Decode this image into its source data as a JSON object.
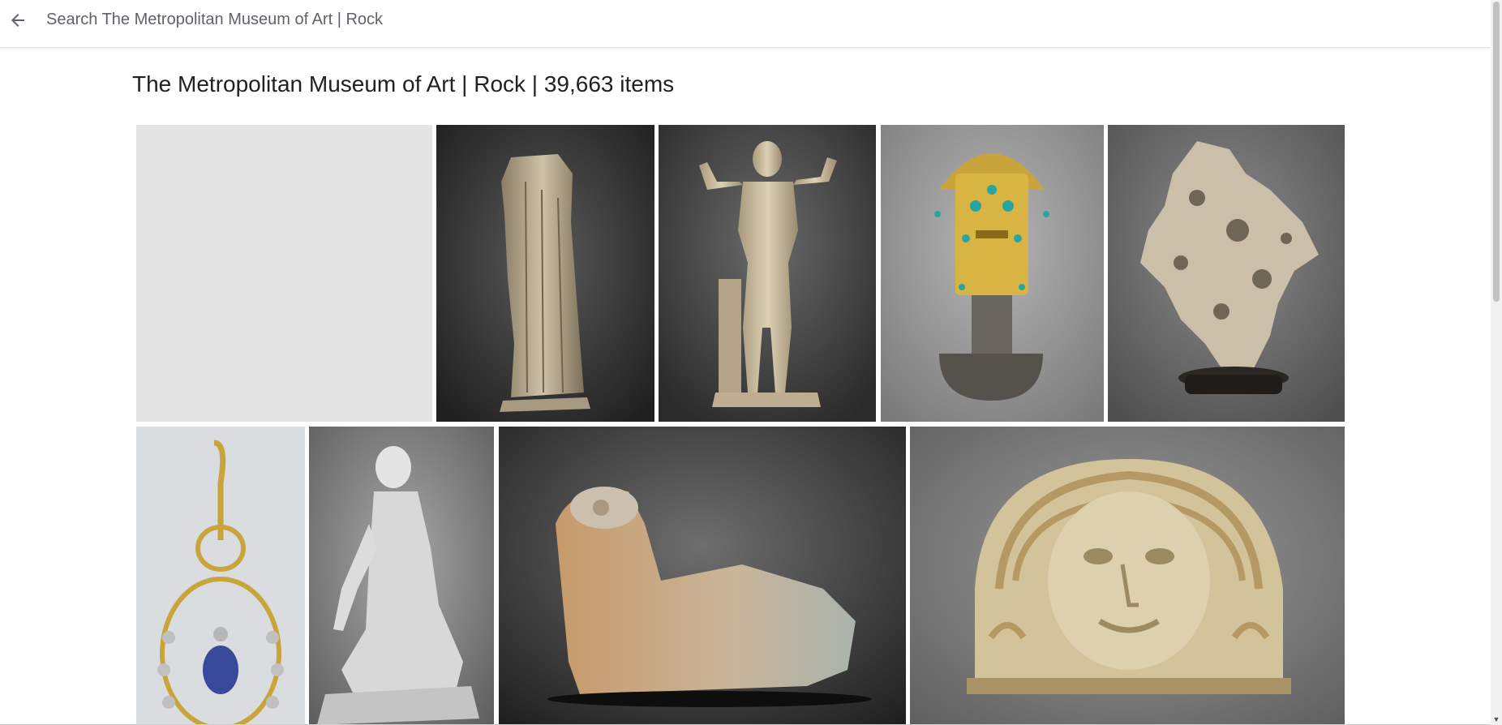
{
  "topbar": {
    "back_icon": "arrow-left-icon",
    "title": "Search The Metropolitan Museum of Art | Rock"
  },
  "heading": "The Metropolitan Museum of Art | Rock | 39,663 items",
  "results": {
    "rows": [
      {
        "items": [
          {
            "subject": "image placeholder (loading)"
          },
          {
            "subject": "headless draped female marble statue"
          },
          {
            "subject": "nude male marble statue beside tree stump"
          },
          {
            "subject": "gold ceremonial tumi knife with turquoise inlay"
          },
          {
            "subject": "scholar's rock on carved wooden stand"
          }
        ]
      },
      {
        "items": [
          {
            "subject": "gold earring with sapphire drop and pearls"
          },
          {
            "subject": "kneeling draped female marble sculpture"
          },
          {
            "subject": "reclining ram stone sculpture"
          },
          {
            "subject": "terracotta antefix with Medusa head"
          }
        ]
      }
    ]
  },
  "colors": {
    "placeholder": "#e4e4e4",
    "heading_text": "#202124",
    "topbar_text": "#5f6368"
  }
}
